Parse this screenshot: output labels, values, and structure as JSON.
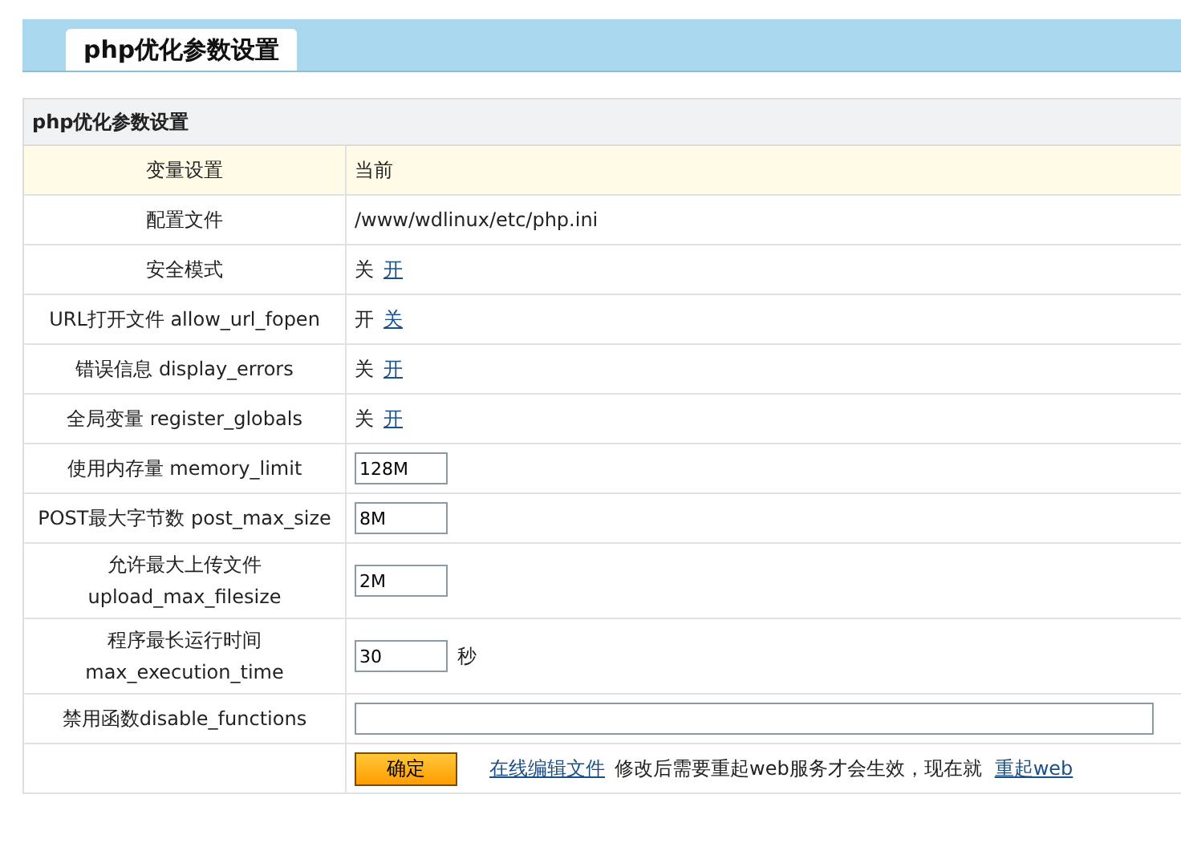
{
  "tab": {
    "label": "php优化参数设置",
    "selected": true
  },
  "section_title": "php优化参数设置",
  "rows": [
    {
      "kind": "header",
      "label": "变量设置",
      "value": "当前"
    },
    {
      "kind": "text",
      "label": "配置文件",
      "value": "/www/wdlinux/etc/php.ini"
    },
    {
      "kind": "switch",
      "label": "安全模式",
      "value": "关",
      "link": "开"
    },
    {
      "kind": "switch",
      "label": "URL打开文件 allow_url_fopen",
      "value": "开",
      "link": "关"
    },
    {
      "kind": "switch",
      "label": "错误信息 display_errors",
      "value": "关",
      "link": "开"
    },
    {
      "kind": "switch",
      "label": "全局变量 register_globals",
      "value": "关",
      "link": "开"
    },
    {
      "kind": "input",
      "label": "使用内存量 memory_limit",
      "value": "128M"
    },
    {
      "kind": "input",
      "label": "POST最大字节数 post_max_size",
      "value": "8M"
    },
    {
      "kind": "input",
      "label": "允许最大上传文件 upload_max_filesize",
      "value": "2M"
    },
    {
      "kind": "input",
      "label": "程序最长运行时间 max_execution_time",
      "value": "30",
      "unit": "秒"
    },
    {
      "kind": "wide-input",
      "label": "禁用函数disable_functions"
    }
  ],
  "footer": {
    "button": "确定",
    "edit_link": "在线编辑文件",
    "note": "修改后需要重起web服务才会生效，现在就",
    "restart_link": "重起web"
  }
}
